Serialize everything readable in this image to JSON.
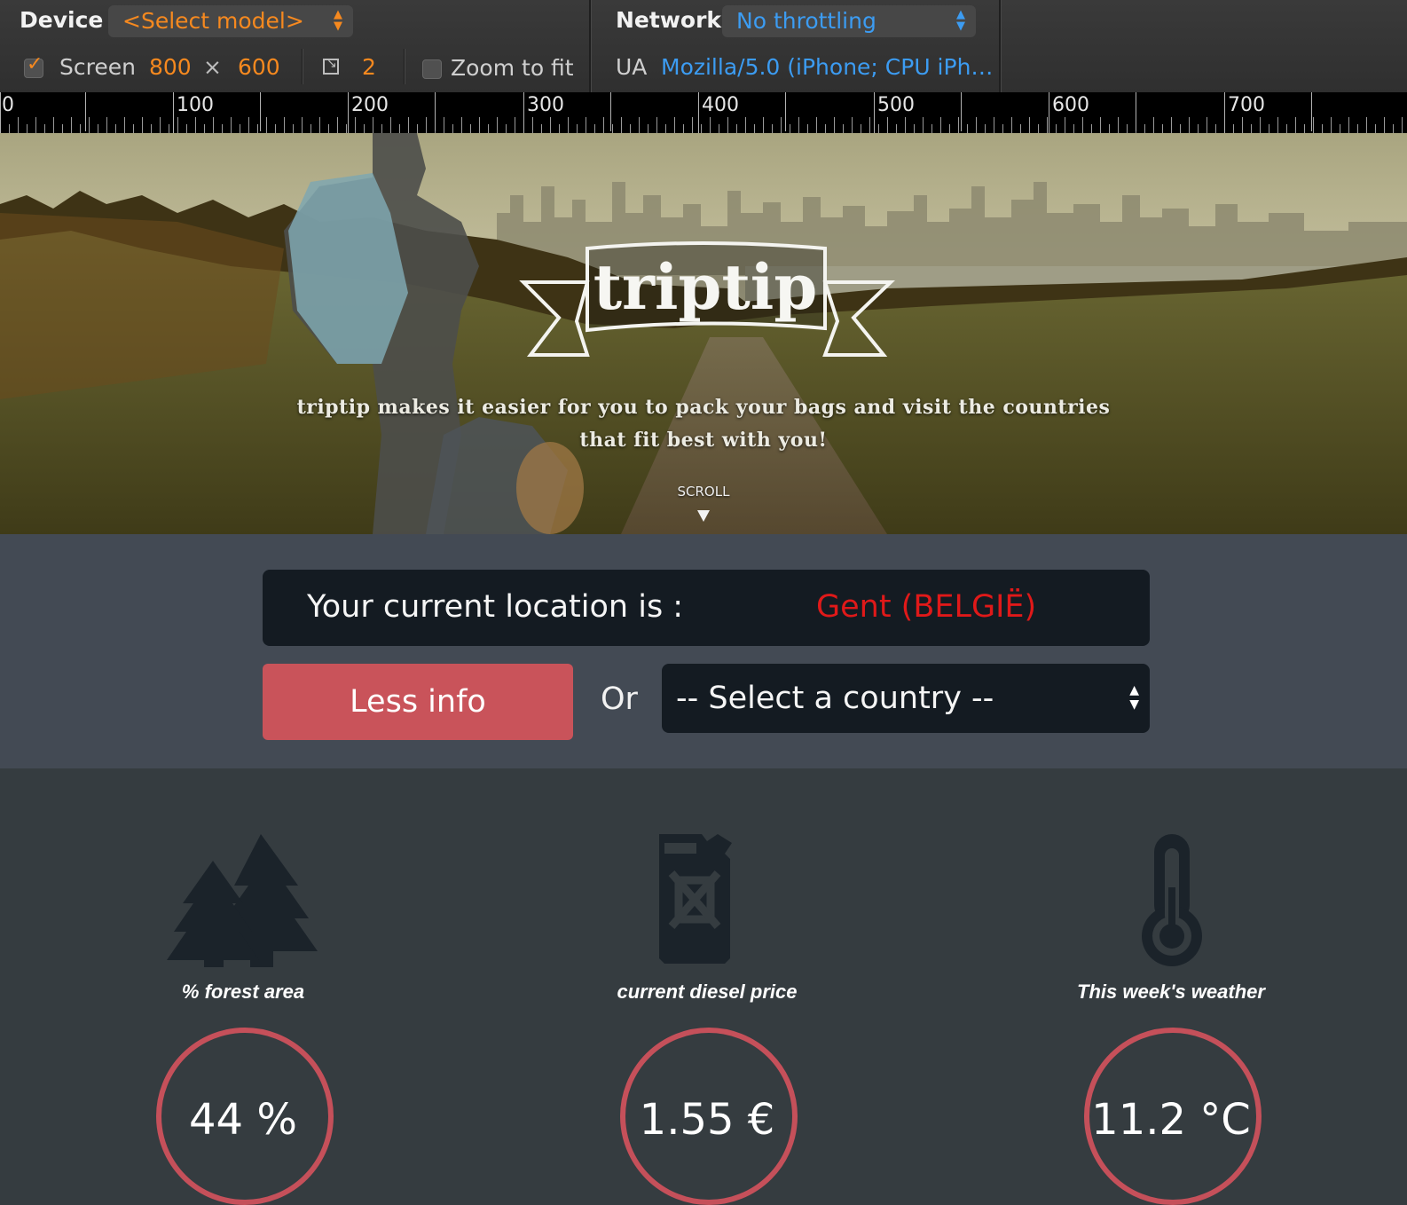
{
  "devtools": {
    "device_label": "Device",
    "device_model": "<Select model>",
    "network_label": "Network",
    "network_value": "No throttling",
    "screen_label": "Screen",
    "screen_width": "800",
    "screen_times": "×",
    "screen_height": "600",
    "pixel_ratio": "2",
    "zoom_to_fit_label": "Zoom to fit",
    "ua_label": "UA",
    "ua_value": "Mozilla/5.0 (iPhone; CPU iPh…",
    "screen_checked": true,
    "zoom_to_fit_checked": false,
    "accent_orange": "#f6891f",
    "accent_blue": "#3c9cf2"
  },
  "ruler": {
    "labels": [
      "0",
      "100",
      "200",
      "300",
      "400",
      "500",
      "600",
      "700"
    ]
  },
  "hero": {
    "logo": "triptip",
    "tagline_line1": "triptip makes it easier for you to pack your bags and visit the countries",
    "tagline_line2": "that fit best with you!",
    "scroll_label": "SCROLL"
  },
  "location": {
    "label": "Your current location is :",
    "value": "Gent (BELGIË)",
    "value_color": "#e01919"
  },
  "actions": {
    "less_info": "Less info",
    "or": "Or",
    "country_select": "-- Select a country --"
  },
  "stats": [
    {
      "icon": "trees-icon",
      "label": "% forest area",
      "value": "44 %"
    },
    {
      "icon": "jerrycan-icon",
      "label": "current diesel price",
      "value": "1.55 €"
    },
    {
      "icon": "thermometer-icon",
      "label": "This week's weather",
      "value": "11.2 °C"
    }
  ],
  "colors": {
    "ring": "#c5505a",
    "button": "#c9535a",
    "panel": "#141b22",
    "band": "#434a54",
    "stats_bg": "#353c40",
    "icon": "#1b232a"
  }
}
